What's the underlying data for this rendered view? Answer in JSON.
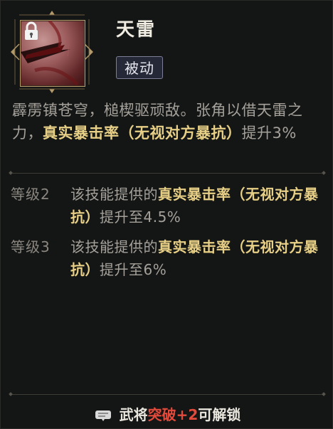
{
  "skill": {
    "name": "天雷",
    "tag": "被动",
    "icon": "lightning-talisman-icon",
    "locked": true
  },
  "description": {
    "part1": "霹雳镇苍穹，槌楔驱顽敌。张角以借天雷之力，",
    "highlight": "真实暴击率（无视对方暴抗）",
    "part2": "提升3%"
  },
  "levels": [
    {
      "label": "等级2",
      "prefix": "该技能提供的",
      "highlight": "真实暴击率（无视对方暴抗）",
      "suffix": "提升至4.5%"
    },
    {
      "label": "等级3",
      "prefix": "该技能提供的",
      "highlight": "真实暴击率（无视对方暴抗）",
      "suffix": "提升至6%"
    }
  ],
  "footer": {
    "prefix": "武将",
    "emphasis": "突破+2",
    "suffix": "可解锁",
    "icon": "scroll-icon"
  },
  "colors": {
    "highlight": "#e7cf86",
    "emphasis": "#e24b3c",
    "tag_bg": "#252836"
  }
}
